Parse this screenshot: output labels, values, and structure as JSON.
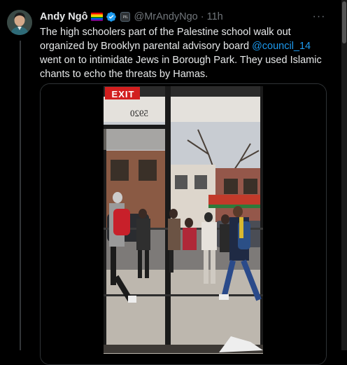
{
  "post": {
    "author_name": "Andy Ngô",
    "handle": "@MrAndyNgo",
    "separator": "·",
    "time": "11h",
    "more_label": "···",
    "text_before": "The high schoolers part of the Palestine school walk out organized by Brooklyn parental advisory board ",
    "mention": "@council_14",
    "text_after": " went on to intimidate Jews in Borough Park. They used Islamic chants to echo the threats by Hamas.",
    "affiliate_badge": "PIL"
  },
  "media": {
    "exit_sign": "EXIT",
    "door_number": "5920"
  },
  "icons": {
    "verified": "verified-badge-icon",
    "flag": "rainbow-flag-icon",
    "more": "more-options-icon"
  },
  "colors": {
    "background": "#000000",
    "text": "#e7e9ea",
    "muted": "#71767b",
    "accent": "#1d9bf0",
    "exit_red": "#d21f1f"
  }
}
